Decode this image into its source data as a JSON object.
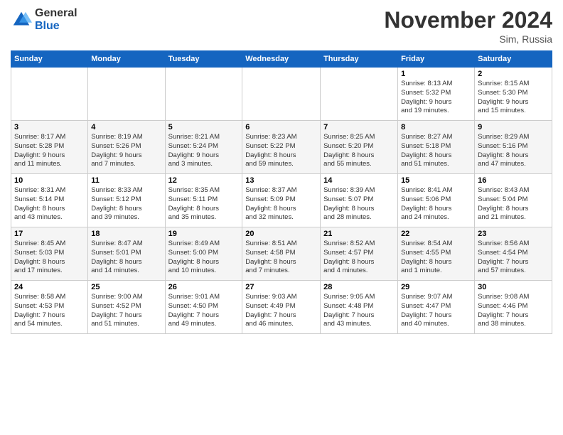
{
  "logo": {
    "general": "General",
    "blue": "Blue"
  },
  "title": "November 2024",
  "location": "Sim, Russia",
  "days_header": [
    "Sunday",
    "Monday",
    "Tuesday",
    "Wednesday",
    "Thursday",
    "Friday",
    "Saturday"
  ],
  "weeks": [
    [
      {
        "day": "",
        "info": ""
      },
      {
        "day": "",
        "info": ""
      },
      {
        "day": "",
        "info": ""
      },
      {
        "day": "",
        "info": ""
      },
      {
        "day": "",
        "info": ""
      },
      {
        "day": "1",
        "info": "Sunrise: 8:13 AM\nSunset: 5:32 PM\nDaylight: 9 hours\nand 19 minutes."
      },
      {
        "day": "2",
        "info": "Sunrise: 8:15 AM\nSunset: 5:30 PM\nDaylight: 9 hours\nand 15 minutes."
      }
    ],
    [
      {
        "day": "3",
        "info": "Sunrise: 8:17 AM\nSunset: 5:28 PM\nDaylight: 9 hours\nand 11 minutes."
      },
      {
        "day": "4",
        "info": "Sunrise: 8:19 AM\nSunset: 5:26 PM\nDaylight: 9 hours\nand 7 minutes."
      },
      {
        "day": "5",
        "info": "Sunrise: 8:21 AM\nSunset: 5:24 PM\nDaylight: 9 hours\nand 3 minutes."
      },
      {
        "day": "6",
        "info": "Sunrise: 8:23 AM\nSunset: 5:22 PM\nDaylight: 8 hours\nand 59 minutes."
      },
      {
        "day": "7",
        "info": "Sunrise: 8:25 AM\nSunset: 5:20 PM\nDaylight: 8 hours\nand 55 minutes."
      },
      {
        "day": "8",
        "info": "Sunrise: 8:27 AM\nSunset: 5:18 PM\nDaylight: 8 hours\nand 51 minutes."
      },
      {
        "day": "9",
        "info": "Sunrise: 8:29 AM\nSunset: 5:16 PM\nDaylight: 8 hours\nand 47 minutes."
      }
    ],
    [
      {
        "day": "10",
        "info": "Sunrise: 8:31 AM\nSunset: 5:14 PM\nDaylight: 8 hours\nand 43 minutes."
      },
      {
        "day": "11",
        "info": "Sunrise: 8:33 AM\nSunset: 5:12 PM\nDaylight: 8 hours\nand 39 minutes."
      },
      {
        "day": "12",
        "info": "Sunrise: 8:35 AM\nSunset: 5:11 PM\nDaylight: 8 hours\nand 35 minutes."
      },
      {
        "day": "13",
        "info": "Sunrise: 8:37 AM\nSunset: 5:09 PM\nDaylight: 8 hours\nand 32 minutes."
      },
      {
        "day": "14",
        "info": "Sunrise: 8:39 AM\nSunset: 5:07 PM\nDaylight: 8 hours\nand 28 minutes."
      },
      {
        "day": "15",
        "info": "Sunrise: 8:41 AM\nSunset: 5:06 PM\nDaylight: 8 hours\nand 24 minutes."
      },
      {
        "day": "16",
        "info": "Sunrise: 8:43 AM\nSunset: 5:04 PM\nDaylight: 8 hours\nand 21 minutes."
      }
    ],
    [
      {
        "day": "17",
        "info": "Sunrise: 8:45 AM\nSunset: 5:03 PM\nDaylight: 8 hours\nand 17 minutes."
      },
      {
        "day": "18",
        "info": "Sunrise: 8:47 AM\nSunset: 5:01 PM\nDaylight: 8 hours\nand 14 minutes."
      },
      {
        "day": "19",
        "info": "Sunrise: 8:49 AM\nSunset: 5:00 PM\nDaylight: 8 hours\nand 10 minutes."
      },
      {
        "day": "20",
        "info": "Sunrise: 8:51 AM\nSunset: 4:58 PM\nDaylight: 8 hours\nand 7 minutes."
      },
      {
        "day": "21",
        "info": "Sunrise: 8:52 AM\nSunset: 4:57 PM\nDaylight: 8 hours\nand 4 minutes."
      },
      {
        "day": "22",
        "info": "Sunrise: 8:54 AM\nSunset: 4:55 PM\nDaylight: 8 hours\nand 1 minute."
      },
      {
        "day": "23",
        "info": "Sunrise: 8:56 AM\nSunset: 4:54 PM\nDaylight: 7 hours\nand 57 minutes."
      }
    ],
    [
      {
        "day": "24",
        "info": "Sunrise: 8:58 AM\nSunset: 4:53 PM\nDaylight: 7 hours\nand 54 minutes."
      },
      {
        "day": "25",
        "info": "Sunrise: 9:00 AM\nSunset: 4:52 PM\nDaylight: 7 hours\nand 51 minutes."
      },
      {
        "day": "26",
        "info": "Sunrise: 9:01 AM\nSunset: 4:50 PM\nDaylight: 7 hours\nand 49 minutes."
      },
      {
        "day": "27",
        "info": "Sunrise: 9:03 AM\nSunset: 4:49 PM\nDaylight: 7 hours\nand 46 minutes."
      },
      {
        "day": "28",
        "info": "Sunrise: 9:05 AM\nSunset: 4:48 PM\nDaylight: 7 hours\nand 43 minutes."
      },
      {
        "day": "29",
        "info": "Sunrise: 9:07 AM\nSunset: 4:47 PM\nDaylight: 7 hours\nand 40 minutes."
      },
      {
        "day": "30",
        "info": "Sunrise: 9:08 AM\nSunset: 4:46 PM\nDaylight: 7 hours\nand 38 minutes."
      }
    ]
  ]
}
